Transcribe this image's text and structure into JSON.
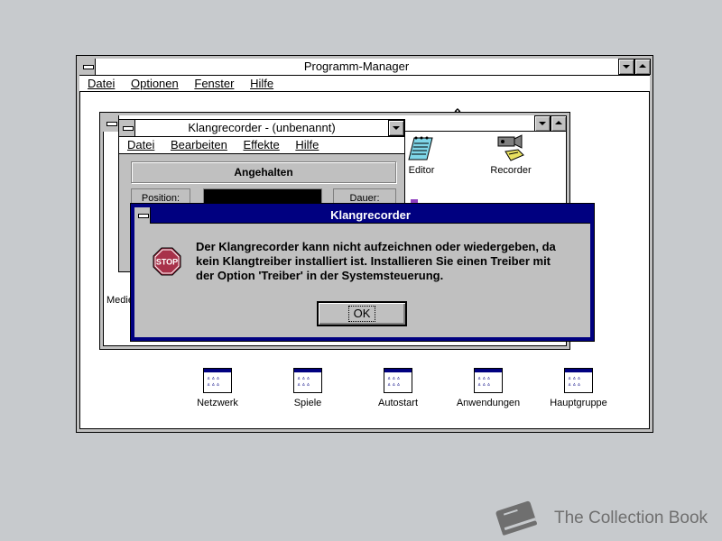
{
  "program_manager": {
    "title": "Programm-Manager",
    "menu": [
      {
        "label": "Datei"
      },
      {
        "label": "Optionen"
      },
      {
        "label": "Fenster"
      },
      {
        "label": "Hilfe"
      }
    ]
  },
  "group_window": {
    "icons": [
      {
        "label": "Editor",
        "icon": "notepad-icon"
      },
      {
        "label": "Recorder",
        "icon": "macro-recorder-icon"
      }
    ],
    "partial_label": "Medie"
  },
  "sound_recorder": {
    "title": "Klangrecorder - (unbenannt)",
    "menu": [
      {
        "label": "Datei"
      },
      {
        "label": "Bearbeiten"
      },
      {
        "label": "Effekte"
      },
      {
        "label": "Hilfe"
      }
    ],
    "status": "Angehalten",
    "position_label": "Position:",
    "duration_label": "Dauer:"
  },
  "dialog": {
    "title": "Klangrecorder",
    "stop_text": "STOP",
    "message_lines": [
      "Der Klangrecorder kann nicht aufzeichnen oder wiedergeben, da",
      "kein Klangtreiber installiert ist. Installieren Sie einen Treiber mit",
      "der Option 'Treiber' in der Systemsteuerung."
    ],
    "ok_label": "OK"
  },
  "program_groups": [
    {
      "label": "Netzwerk"
    },
    {
      "label": "Spiele"
    },
    {
      "label": "Autostart"
    },
    {
      "label": "Anwendungen"
    },
    {
      "label": "Hauptgruppe"
    }
  ],
  "watermark": {
    "text": "The Collection Book",
    "icon": "book-icon"
  },
  "colors": {
    "titlebar_active": "#000080",
    "desktop": "#c7cacd",
    "dialog_border": "#000080",
    "stop_sign": "#a8324a"
  }
}
